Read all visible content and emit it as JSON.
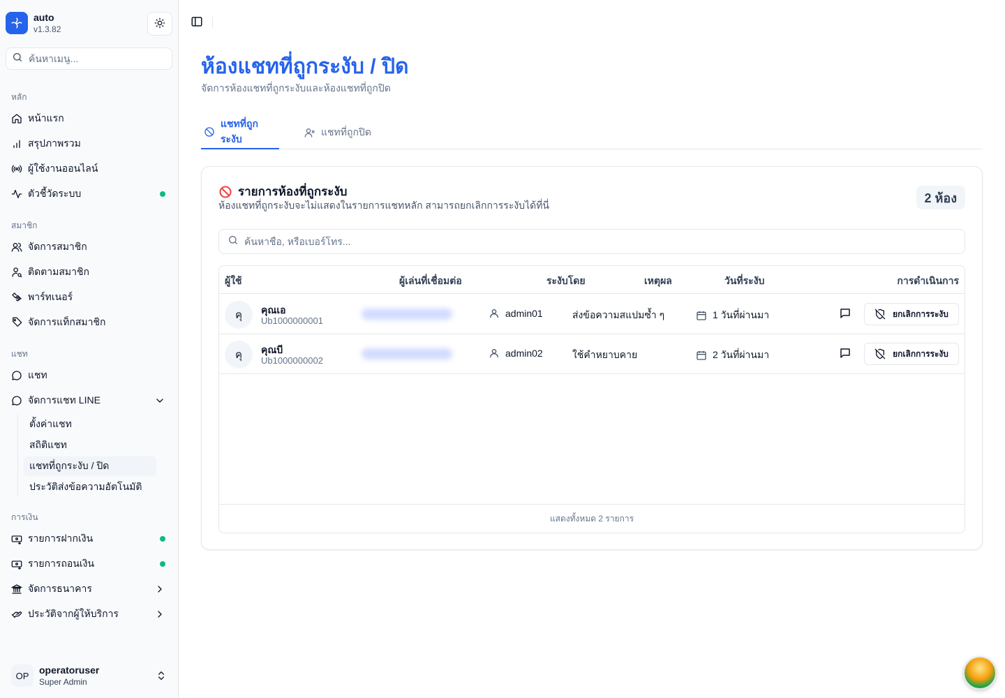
{
  "app": {
    "name": "auto",
    "version": "v1.3.82",
    "accent": "#2563eb",
    "status_green": "#10b981"
  },
  "sidebar": {
    "search_placeholder": "ค้นหาเมนู...",
    "groups": {
      "main": {
        "label": "หลัก",
        "items": [
          {
            "label": "หน้าแรก",
            "icon": "home-icon"
          },
          {
            "label": "สรุปภาพรวม",
            "icon": "bar-chart-icon"
          },
          {
            "label": "ผู้ใช้งานออนไลน์",
            "icon": "radio-icon"
          },
          {
            "label": "ตัวชี้วัดระบบ",
            "icon": "activity-icon",
            "status": "green-dot"
          }
        ]
      },
      "members": {
        "label": "สมาชิก",
        "items": [
          {
            "label": "จัดการสมาชิก",
            "icon": "users-icon"
          },
          {
            "label": "ติดตามสมาชิก",
            "icon": "user-search-icon"
          },
          {
            "label": "พาร์ทเนอร์",
            "icon": "handshake-icon"
          },
          {
            "label": "จัดการแท็กสมาชิก",
            "icon": "tag-icon"
          }
        ]
      },
      "chat": {
        "label": "แชท",
        "items": [
          {
            "label": "แชท",
            "icon": "message-circle-icon"
          },
          {
            "label": "จัดการแชท LINE",
            "icon": "message-circle-icon",
            "expanded": true
          }
        ],
        "sub_items": [
          {
            "label": "ตั้งค่าแชท"
          },
          {
            "label": "สถิติแชท"
          },
          {
            "label": "แชทที่ถูกระงับ / ปิด",
            "active": true
          },
          {
            "label": "ประวัติส่งข้อความอัตโนมัติ"
          }
        ]
      },
      "finance": {
        "label": "การเงิน",
        "items": [
          {
            "label": "รายการฝากเงิน",
            "icon": "deposit-icon",
            "status": "green-dot"
          },
          {
            "label": "รายการถอนเงิน",
            "icon": "withdraw-icon",
            "status": "green-dot"
          },
          {
            "label": "จัดการธนาคาร",
            "icon": "bank-icon"
          },
          {
            "label": "ประวัติจากผู้ให้บริการ",
            "icon": "provider-icon"
          }
        ]
      }
    },
    "user": {
      "initials": "OP",
      "name": "operatoruser",
      "role": "Super Admin"
    }
  },
  "main": {
    "title": "ห้องแชทที่ถูกระงับ / ปิด",
    "subtitle": "จัดการห้องแชทที่ถูกระงับและห้องแชทที่ถูกปิด",
    "tabs": [
      {
        "label": "แชทที่ถูกระงับ",
        "active": true
      },
      {
        "label": "แชทที่ถูกปิด",
        "active": false
      }
    ],
    "card": {
      "title": "รายการห้องที่ถูกระงับ",
      "description": "ห้องแชทที่ถูกระงับจะไม่แสดงในรายการแชทหลัก สามารถยกเลิกการระงับได้ที่นี่",
      "count_badge": "2 ห้อง",
      "search_placeholder": "ค้นหาชื่อ, หรือเบอร์โทร...",
      "columns": {
        "user": "ผู้ใช้",
        "linked_player": "ผู้เล่นที่เชื่อมต่อ",
        "banned_by": "ระงับโดย",
        "reason": "เหตุผล",
        "banned_date": "วันที่ระงับ",
        "actions": "การดำเนินการ"
      },
      "rows": [
        {
          "avatar": "คุ",
          "name": "คุณเอ",
          "uid": "Ub1000000001",
          "banned_by": "admin01",
          "reason": "ส่งข้อความสแปมซ้ำ ๆ",
          "date": "1 วันที่ผ่านมา",
          "unban_label": "ยกเลิกการระงับ"
        },
        {
          "avatar": "คุ",
          "name": "คุณบี",
          "uid": "Ub1000000002",
          "banned_by": "admin02",
          "reason": "ใช้คำหยาบคาย",
          "date": "2 วันที่ผ่านมา",
          "unban_label": "ยกเลิกการระงับ"
        }
      ],
      "footer": "แสดงทั้งหมด 2 รายการ"
    }
  }
}
